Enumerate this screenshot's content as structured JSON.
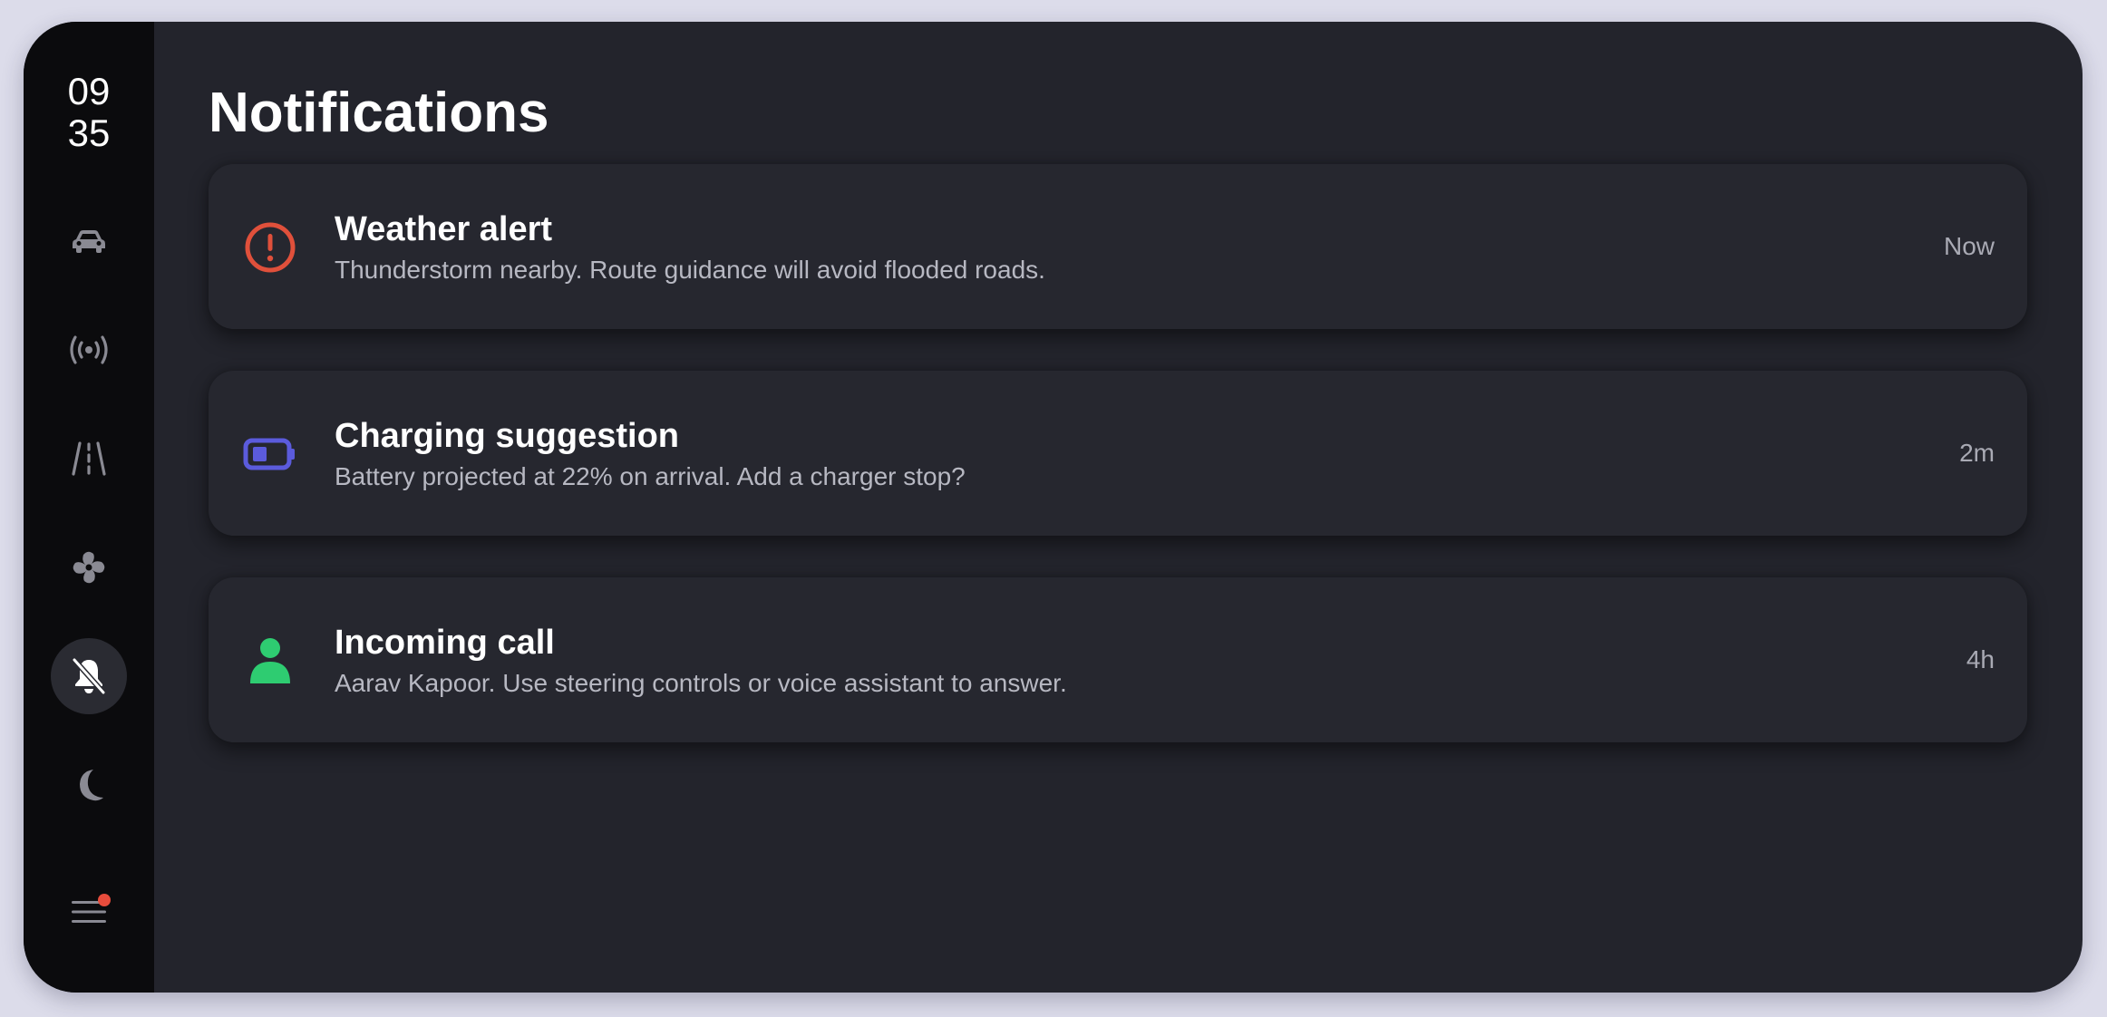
{
  "clock": {
    "hours": "09",
    "minutes": "35"
  },
  "sidebar": {
    "items": [
      {
        "id": "vehicle",
        "icon": "car-icon"
      },
      {
        "id": "connectivity",
        "icon": "broadcast-icon"
      },
      {
        "id": "road",
        "icon": "road-icon"
      },
      {
        "id": "climate",
        "icon": "fan-icon"
      },
      {
        "id": "notifications",
        "icon": "bell-off-icon",
        "active": true
      },
      {
        "id": "night-mode",
        "icon": "moon-icon"
      },
      {
        "id": "menu",
        "icon": "hamburger-menu-icon",
        "has_badge": true
      }
    ]
  },
  "page": {
    "title": "Notifications"
  },
  "notifications": [
    {
      "title": "Weather alert",
      "body": "Thunderstorm nearby. Route guidance will avoid flooded roads.",
      "time": "Now",
      "icon": "alert-circle-icon",
      "color": "#e0503b"
    },
    {
      "title": "Charging suggestion",
      "body": "Battery projected at 22% on arrival. Add a charger stop?",
      "time": "2m",
      "icon": "battery-icon",
      "color": "#5b5bdc"
    },
    {
      "title": "Incoming call",
      "body": "Aarav Kapoor. Use steering controls or voice assistant to answer.",
      "time": "4h",
      "icon": "person-icon",
      "color": "#2ecc71"
    }
  ],
  "colors": {
    "accent_badge": "#e74c3c",
    "rail_icon": "#8a8a93",
    "background": "#23242c"
  }
}
